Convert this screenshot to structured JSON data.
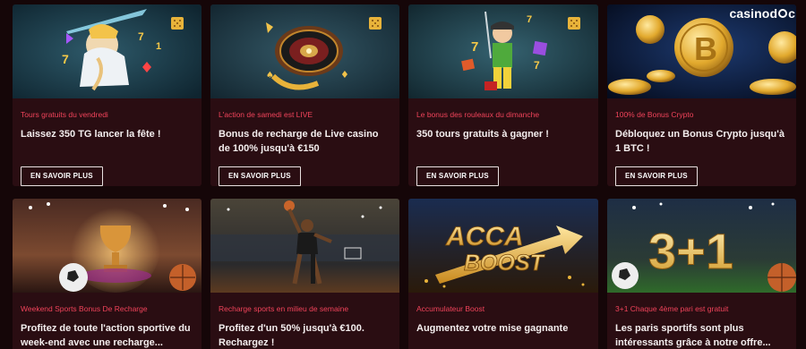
{
  "brand": {
    "name_part1": "casinod",
    "name_part2": "c"
  },
  "cards": [
    {
      "tag": "Tours gratuits du vendredi",
      "title": "Laissez 350 TG lancer la fête !",
      "button": "EN SAVOIR PLUS",
      "image_icon": "zeus-slot-image"
    },
    {
      "tag": "L'action de samedi est LIVE",
      "title": "Bonus de recharge de Live casino de 100% jusqu'à €150",
      "button": "EN SAVOIR PLUS",
      "image_icon": "roulette-wheel-image"
    },
    {
      "tag": "Le bonus des rouleaux du dimanche",
      "title": "350 tours gratuits à gagner !",
      "button": "EN SAVOIR PLUS",
      "image_icon": "miner-slot-image"
    },
    {
      "tag": "100% de Bonus Crypto",
      "title": "Débloquez un Bonus Crypto jusqu'à 1 BTC !",
      "button": "EN SAVOIR PLUS",
      "image_icon": "bitcoin-coins-image"
    },
    {
      "tag": "Weekend Sports Bonus De Recharge",
      "title": "Profitez de toute l'action sportive du week-end avec une recharge...",
      "image_icon": "trophy-stadium-image"
    },
    {
      "tag": "Recharge sports en milieu de semaine",
      "title": "Profitez d'un 50% jusqu'à €100. Rechargez !",
      "image_icon": "basketball-player-image"
    },
    {
      "tag": "Accumulateur Boost",
      "title": "Augmentez votre mise gagnante",
      "image_icon": "acca-boost-image",
      "image_text": [
        "ACCA",
        "BOOST"
      ]
    },
    {
      "tag": "3+1 Chaque 4ème pari est gratuit",
      "title": "Les paris sportifs sont plus intéressants grâce à notre offre...",
      "image_icon": "three-plus-one-image",
      "image_text": [
        "3+1"
      ]
    }
  ],
  "colors": {
    "background": "#150608",
    "card": "#2a0d12",
    "tag": "#f0435a",
    "gold": "#e8b33a"
  }
}
